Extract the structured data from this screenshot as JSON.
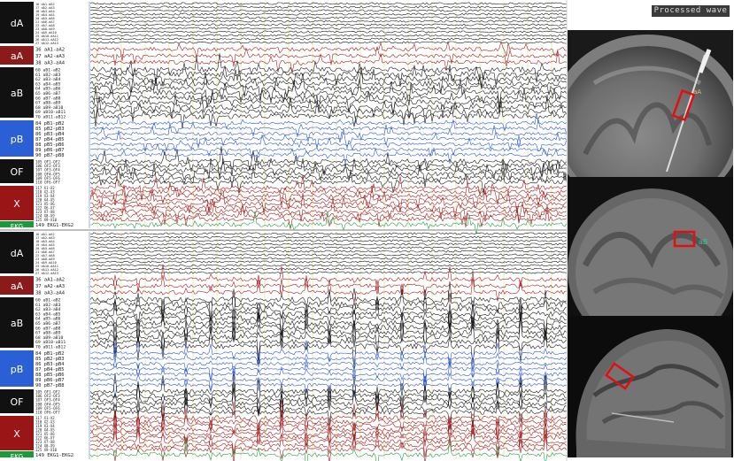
{
  "status": {
    "processing_badge": "Processed wave"
  },
  "region_labels": [
    "dA",
    "aA",
    "aB",
    "pB",
    "OF",
    "X",
    "EKG"
  ],
  "region_colors": {
    "dA": "#111111",
    "aA": "#8b1a1a",
    "aB": "#111111",
    "pB": "#2a5fd6",
    "OF": "#111111",
    "X": "#9a1616",
    "EKG": "#1a9a3a"
  },
  "trace_colors": {
    "black": "#1a1a1a",
    "red": "#a02020",
    "blue": "#2e59d0",
    "green": "#20a040"
  },
  "panels": [
    {
      "groups": [
        {
          "label": "dA",
          "color": "#111111",
          "trace": "black",
          "channels": [
            "16 dA1-dA2",
            "17 dA2-dA3",
            "18 dA3-dA4",
            "19 dA4-dA5",
            "20 dA5-dA6",
            "21 dA6-dA7",
            "22 dA7-dA8",
            "23 dA8-dA9",
            "24 dA9-dA10",
            "25 dA10-dA11",
            "26 dA11-dA12",
            "27 dA12-dA13"
          ]
        },
        {
          "label": "aA",
          "color": "#8b1a1a",
          "trace": "red",
          "channels": [
            "36 aA1-aA2",
            "37 aA2-aA3",
            "38 aA3-aA4"
          ]
        },
        {
          "label": "aB",
          "color": "#111111",
          "trace": "black",
          "channels": [
            "60 aB1-aB2",
            "61 aB2-aB3",
            "62 aB3-aB4",
            "63 aB4-aB5",
            "64 aB5-aB6",
            "65 aB6-aB7",
            "66 aB7-aB8",
            "67 aB8-aB9",
            "68 aB9-aB10",
            "69 aB10-aB11",
            "70 aB11-aB12"
          ]
        },
        {
          "label": "pB",
          "color": "#2a5fd6",
          "trace": "blue",
          "channels": [
            "84 pB1-pB2",
            "85 pB2-pB3",
            "86 pB3-pB4",
            "87 pB4-pB5",
            "88 pB5-pB6",
            "89 pB6-pB7",
            "90 pB7-pB8"
          ]
        },
        {
          "label": "OF",
          "color": "#111111",
          "trace": "black",
          "channels": [
            "105 OF1-OF2",
            "106 OF2-OF3",
            "107 OF3-OF4",
            "108 OF4-OF5",
            "109 OF5-OF6",
            "110 OF6-OF7"
          ]
        },
        {
          "label": "X",
          "color": "#9a1616",
          "trace": "red",
          "channels": [
            "117 X1-X2",
            "118 X2-X3",
            "119 X3-X4",
            "120 X4-X5",
            "121 X5-X6",
            "122 X6-X7",
            "123 X7-X8",
            "124 X8-X9",
            "125 X9-X10"
          ]
        },
        {
          "label": "EKG",
          "color": "#1a9a3a",
          "trace": "green",
          "channels": [
            "149 EKG1-EKG2"
          ]
        }
      ]
    },
    {
      "groups": [
        {
          "label": "dA",
          "color": "#111111",
          "trace": "black",
          "channels": [
            "16 dA1-dA2",
            "17 dA2-dA3",
            "18 dA3-dA4",
            "19 dA4-dA5",
            "20 dA5-dA6",
            "21 dA6-dA7",
            "22 dA7-dA8",
            "23 dA8-dA9",
            "24 dA9-dA10",
            "25 dA10-dA11",
            "26 dA11-dA12",
            "27 dA12-dA13"
          ]
        },
        {
          "label": "aA",
          "color": "#8b1a1a",
          "trace": "red",
          "channels": [
            "36 aA1-aA2",
            "37 aA2-aA3",
            "38 aA3-aA4"
          ]
        },
        {
          "label": "aB",
          "color": "#111111",
          "trace": "black",
          "channels": [
            "60 aB1-aB2",
            "61 aB2-aB3",
            "62 aB3-aB4",
            "63 aB4-aB5",
            "64 aB5-aB6",
            "65 aB6-aB7",
            "66 aB7-aB8",
            "67 aB8-aB9",
            "68 aB9-aB10",
            "69 aB10-aB11",
            "70 aB11-aB12"
          ]
        },
        {
          "label": "pB",
          "color": "#2a5fd6",
          "trace": "blue",
          "channels": [
            "84 pB1-pB2",
            "85 pB2-pB3",
            "86 pB3-pB4",
            "87 pB4-pB5",
            "88 pB5-pB6",
            "89 pB6-pB7",
            "90 pB7-pB8"
          ]
        },
        {
          "label": "OF",
          "color": "#111111",
          "trace": "black",
          "channels": [
            "105 OF1-OF2",
            "106 OF2-OF3",
            "107 OF3-OF4",
            "108 OF4-OF5",
            "109 OF5-OF6",
            "110 OF6-OF7"
          ]
        },
        {
          "label": "X",
          "color": "#9a1616",
          "trace": "red",
          "channels": [
            "117 X1-X2",
            "118 X2-X3",
            "119 X3-X4",
            "120 X4-X5",
            "121 X5-X6",
            "122 X6-X7",
            "123 X7-X8",
            "124 X8-X9",
            "125 X9-X10"
          ]
        },
        {
          "label": "EKG",
          "color": "#1a9a3a",
          "trace": "green",
          "channels": [
            "149 EKG1-EKG2"
          ]
        }
      ]
    }
  ],
  "mri_views": [
    {
      "name": "coronal-view-1",
      "annotation": "aA"
    },
    {
      "name": "coronal-view-2",
      "annotation": "aB"
    },
    {
      "name": "sagittal-view",
      "annotation": ""
    }
  ]
}
